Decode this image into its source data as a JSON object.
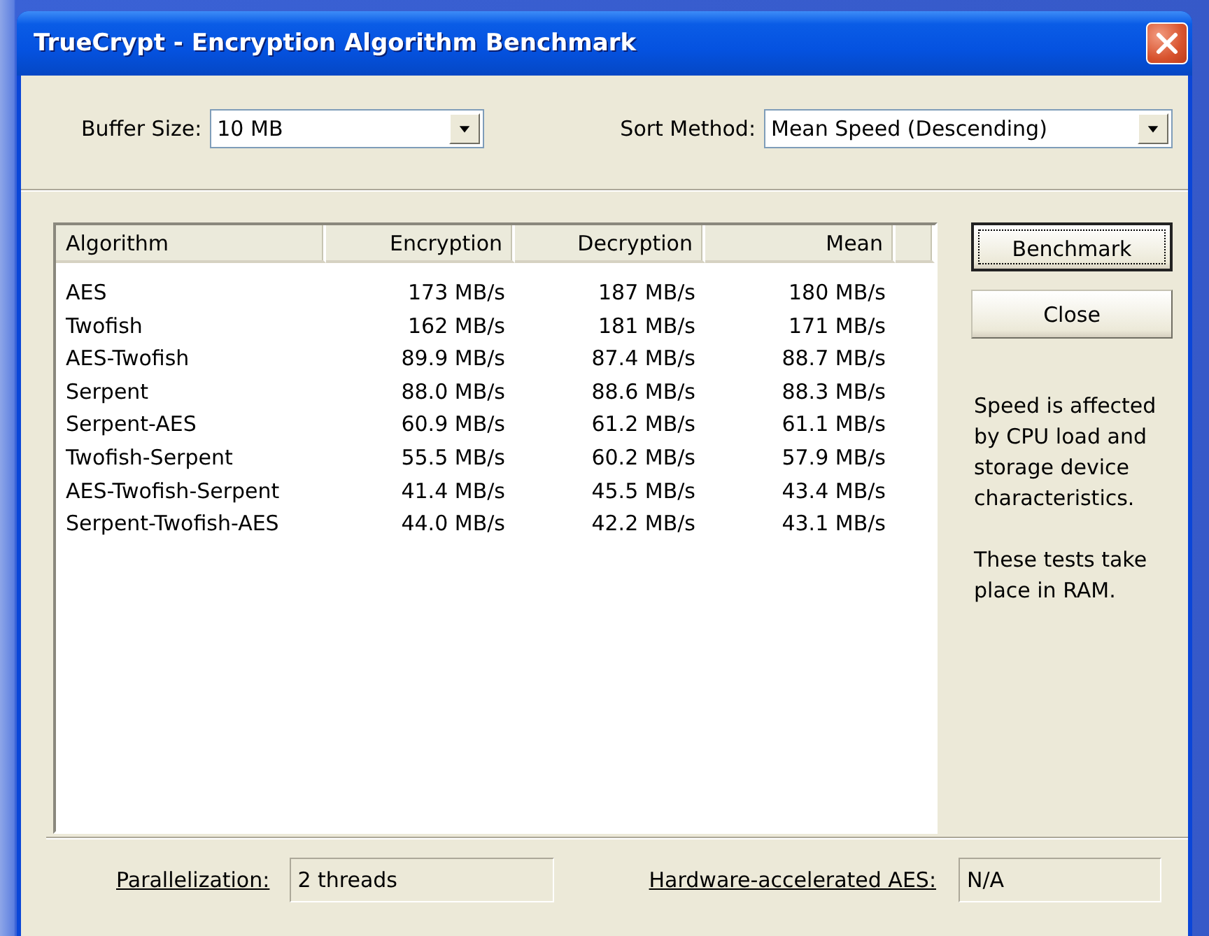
{
  "window": {
    "title": "TrueCrypt - Encryption Algorithm Benchmark"
  },
  "buffer_size": {
    "label": "Buffer Size:",
    "value": "10 MB"
  },
  "sort_method": {
    "label": "Sort Method:",
    "value": "Mean Speed (Descending)"
  },
  "table": {
    "columns": [
      "Algorithm",
      "Encryption",
      "Decryption",
      "Mean"
    ],
    "rows": [
      [
        "AES",
        "173 MB/s",
        "187 MB/s",
        "180 MB/s"
      ],
      [
        "Twofish",
        "162 MB/s",
        "181 MB/s",
        "171 MB/s"
      ],
      [
        "AES-Twofish",
        "89.9 MB/s",
        "87.4 MB/s",
        "88.7 MB/s"
      ],
      [
        "Serpent",
        "88.0 MB/s",
        "88.6 MB/s",
        "88.3 MB/s"
      ],
      [
        "Serpent-AES",
        "60.9 MB/s",
        "61.2 MB/s",
        "61.1 MB/s"
      ],
      [
        "Twofish-Serpent",
        "55.5 MB/s",
        "60.2 MB/s",
        "57.9 MB/s"
      ],
      [
        "AES-Twofish-Serpent",
        "41.4 MB/s",
        "45.5 MB/s",
        "43.4 MB/s"
      ],
      [
        "Serpent-Twofish-AES",
        "44.0 MB/s",
        "42.2 MB/s",
        "43.1 MB/s"
      ]
    ]
  },
  "buttons": [
    {
      "label": "Benchmark",
      "focused": true
    },
    {
      "label": "Close",
      "focused": false
    }
  ],
  "notes": [
    "Speed is affected by CPU load and storage device characteristics.",
    "These tests take place in RAM."
  ],
  "parallelization": {
    "label": "Parallelization:",
    "value": "2 threads"
  },
  "hardware_aes": {
    "label": "Hardware-accelerated AES:",
    "value": "N/A"
  }
}
